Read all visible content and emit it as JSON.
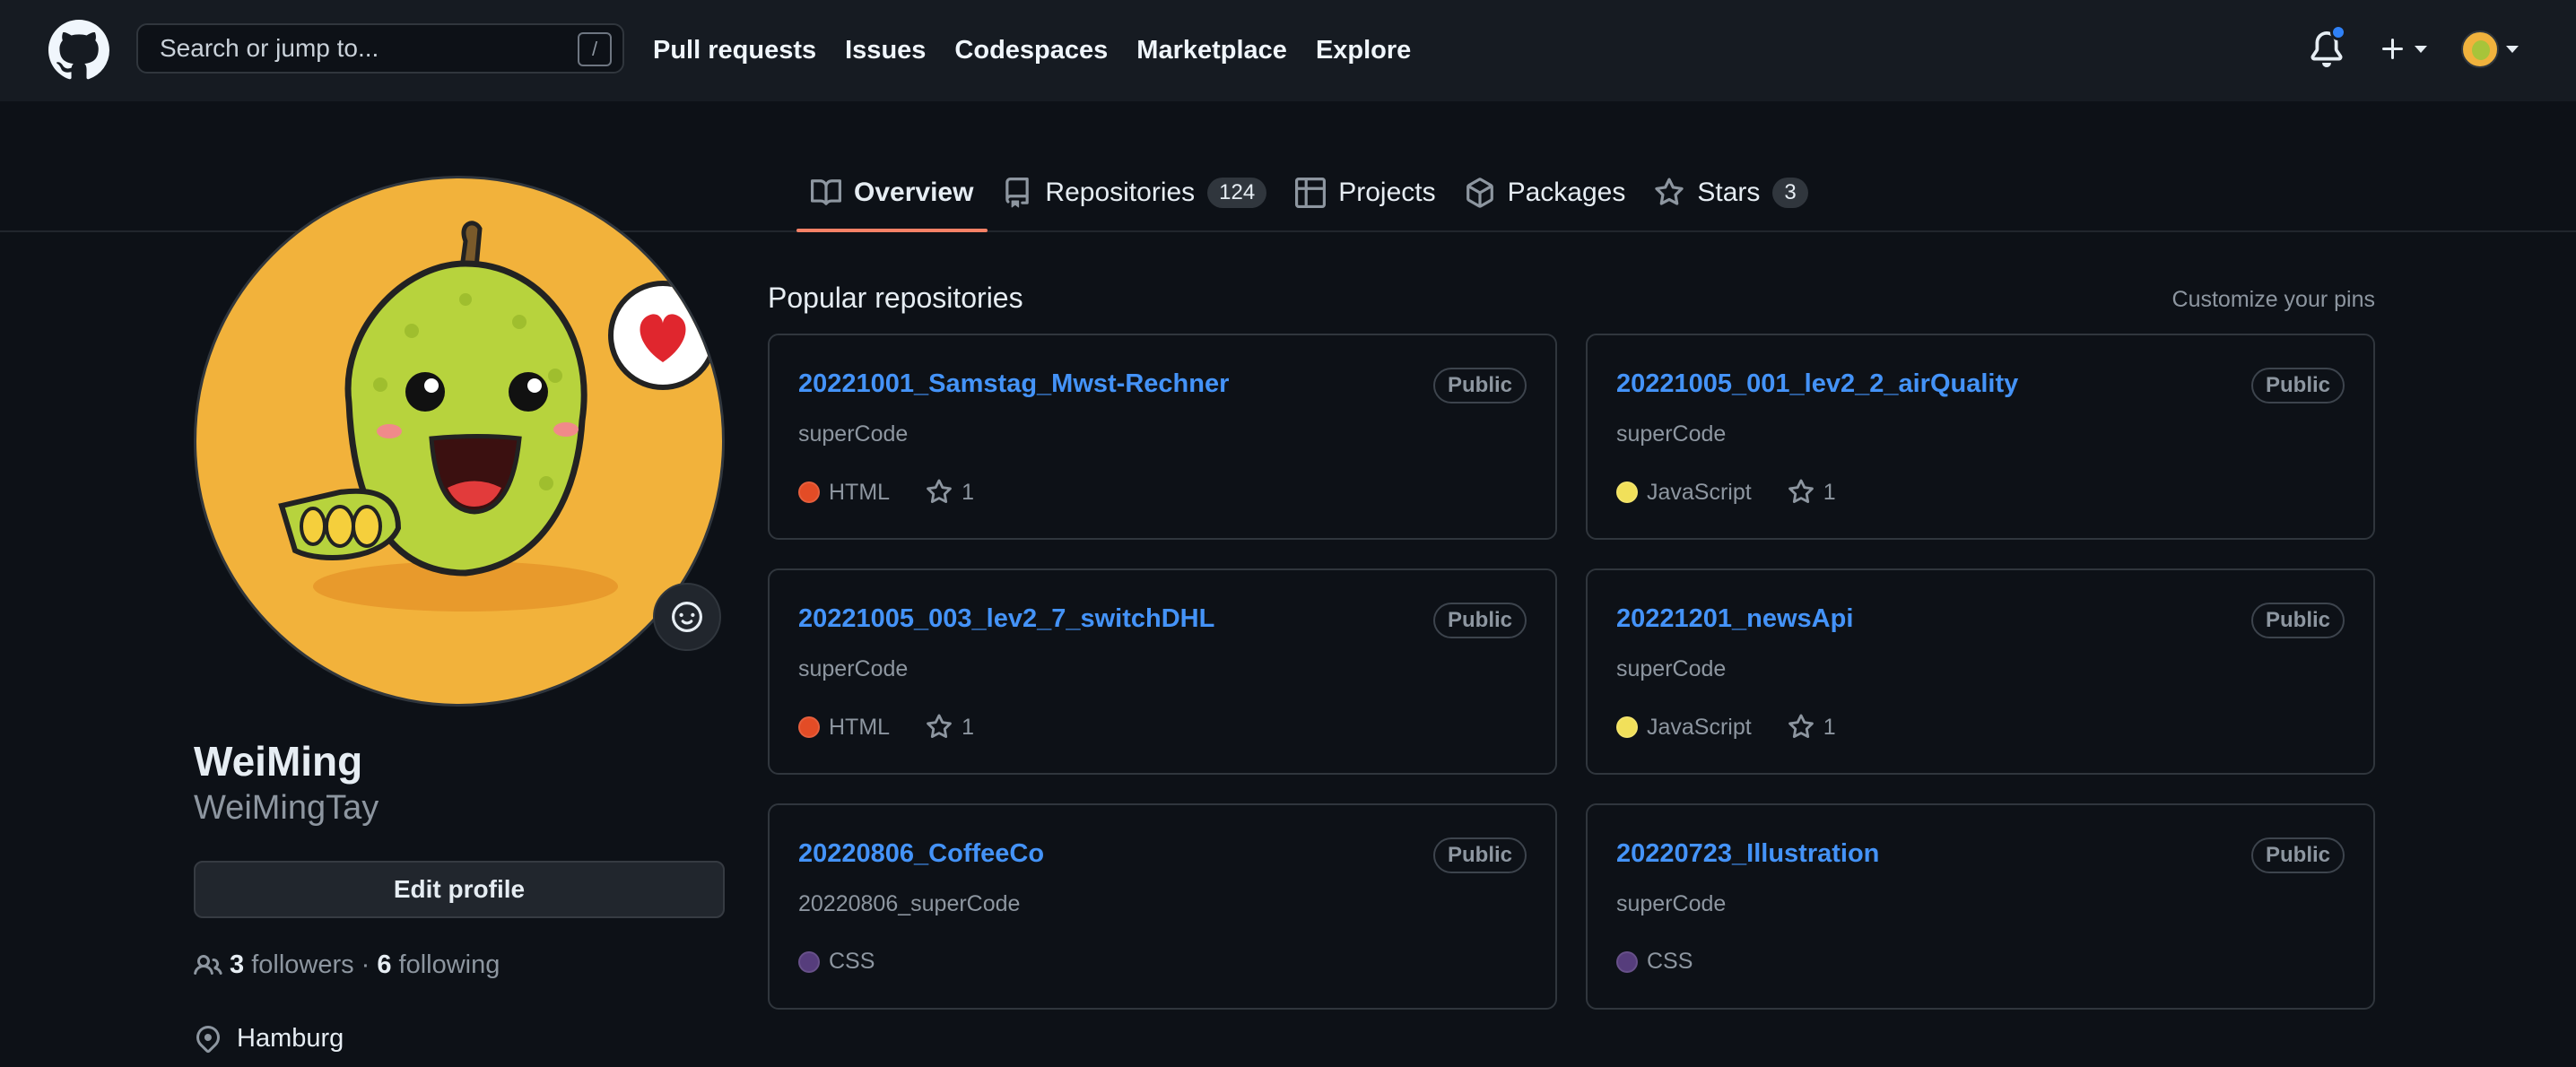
{
  "header": {
    "search_placeholder": "Search or jump to...",
    "search_shortcut": "/",
    "nav": [
      "Pull requests",
      "Issues",
      "Codespaces",
      "Marketplace",
      "Explore"
    ],
    "notification_dot_color": "#2f81f7"
  },
  "tabs": [
    {
      "label": "Overview",
      "icon": "book-icon",
      "active": true
    },
    {
      "label": "Repositories",
      "icon": "repo-icon",
      "count": "124"
    },
    {
      "label": "Projects",
      "icon": "table-icon"
    },
    {
      "label": "Packages",
      "icon": "package-icon"
    },
    {
      "label": "Stars",
      "icon": "star-icon",
      "count": "3"
    }
  ],
  "profile": {
    "name": "WeiMing",
    "login": "WeiMingTay",
    "edit_label": "Edit profile",
    "followers_count": "3",
    "followers_label": "followers",
    "separator": "·",
    "following_count": "6",
    "following_label": "following",
    "location": "Hamburg"
  },
  "popular": {
    "title": "Popular repositories",
    "customize": "Customize your pins",
    "repos": [
      {
        "name": "20221001_Samstag_Mwst-Rechner",
        "visibility": "Public",
        "desc": "superCode",
        "lang": "HTML",
        "lang_color": "#e34c26",
        "stars": "1"
      },
      {
        "name": "20221005_001_lev2_2_airQuality",
        "visibility": "Public",
        "desc": "superCode",
        "lang": "JavaScript",
        "lang_color": "#f1e05a",
        "stars": "1"
      },
      {
        "name": "20221005_003_lev2_7_switchDHL",
        "visibility": "Public",
        "desc": "superCode",
        "lang": "HTML",
        "lang_color": "#e34c26",
        "stars": "1"
      },
      {
        "name": "20221201_newsApi",
        "visibility": "Public",
        "desc": "superCode",
        "lang": "JavaScript",
        "lang_color": "#f1e05a",
        "stars": "1"
      },
      {
        "name": "20220806_CoffeeCo",
        "visibility": "Public",
        "desc": "20220806_superCode",
        "lang": "CSS",
        "lang_color": "#563d7c",
        "stars": ""
      },
      {
        "name": "20220723_Illustration",
        "visibility": "Public",
        "desc": "superCode",
        "lang": "CSS",
        "lang_color": "#563d7c",
        "stars": ""
      }
    ]
  }
}
